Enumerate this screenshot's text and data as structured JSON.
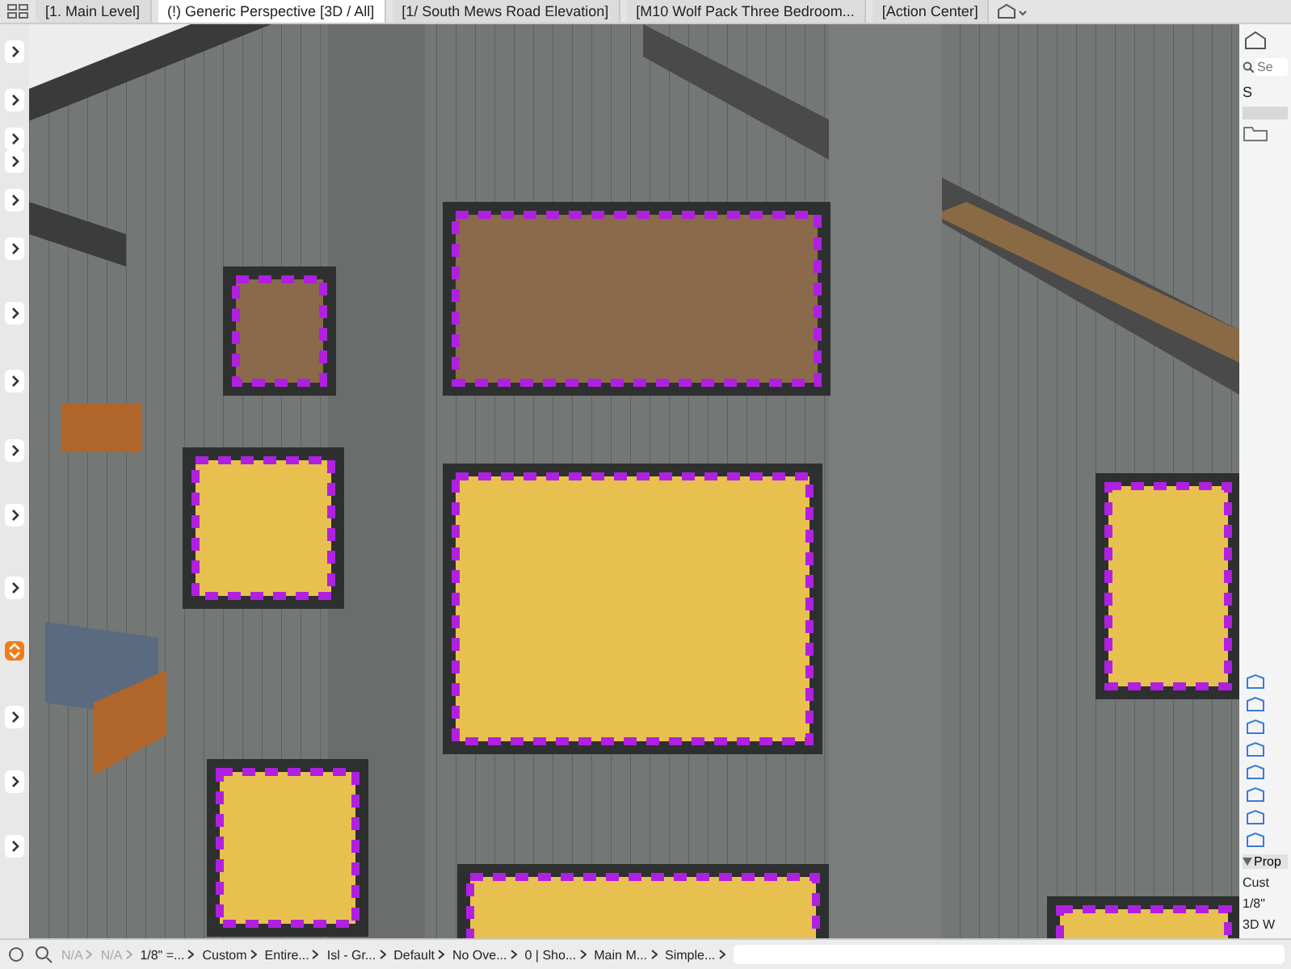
{
  "tabs": [
    {
      "label": "[1. Main Level]",
      "selected": false
    },
    {
      "label": "(!) Generic Perspective [3D / All]",
      "selected": true
    },
    {
      "label": "[1/ South Mews Road Elevation]",
      "selected": false
    },
    {
      "label": "[M10 Wolf Pack Three Bedroom...",
      "selected": false
    },
    {
      "label": "[Action Center]",
      "selected": false
    }
  ],
  "navigator": {
    "search_placeholder": "Se",
    "tree_label": "S",
    "properties_title": "Prop",
    "properties_rows": [
      "Cust",
      "1/8\"",
      "3D W"
    ]
  },
  "status_bar": [
    {
      "text": "N/A",
      "disabled": true
    },
    {
      "text": "N/A",
      "disabled": true
    },
    {
      "text": "1/8\"  =...",
      "disabled": false
    },
    {
      "text": "Custom",
      "disabled": false
    },
    {
      "text": "Entire...",
      "disabled": false
    },
    {
      "text": "Isl - Gr...",
      "disabled": false
    },
    {
      "text": "Default",
      "disabled": false
    },
    {
      "text": "No Ove...",
      "disabled": false
    },
    {
      "text": "0 | Sho...",
      "disabled": false
    },
    {
      "text": "Main M...",
      "disabled": false
    },
    {
      "text": "Simple...",
      "disabled": false
    }
  ]
}
